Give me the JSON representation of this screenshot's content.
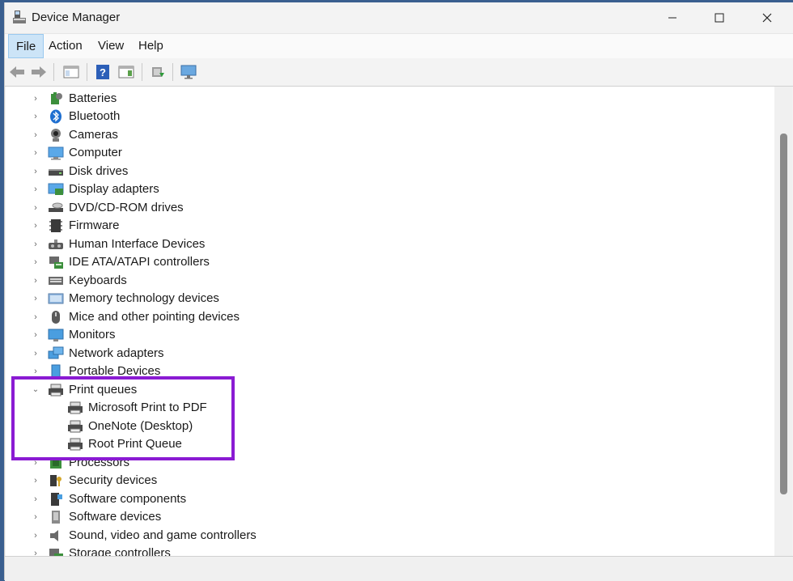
{
  "window": {
    "title": "Device Manager"
  },
  "menu": [
    {
      "label": "File"
    },
    {
      "label": "Action"
    },
    {
      "label": "View"
    },
    {
      "label": "Help"
    }
  ],
  "tree": {
    "items": [
      {
        "label": "Batteries",
        "icon": "battery-icon"
      },
      {
        "label": "Bluetooth",
        "icon": "bluetooth-icon"
      },
      {
        "label": "Cameras",
        "icon": "camera-icon"
      },
      {
        "label": "Computer",
        "icon": "computer-icon"
      },
      {
        "label": "Disk drives",
        "icon": "disk-drive-icon"
      },
      {
        "label": "Display adapters",
        "icon": "display-adapter-icon"
      },
      {
        "label": "DVD/CD-ROM drives",
        "icon": "dvd-drive-icon"
      },
      {
        "label": "Firmware",
        "icon": "firmware-icon"
      },
      {
        "label": "Human Interface Devices",
        "icon": "hid-icon"
      },
      {
        "label": "IDE ATA/ATAPI controllers",
        "icon": "ide-controller-icon"
      },
      {
        "label": "Keyboards",
        "icon": "keyboard-icon"
      },
      {
        "label": "Memory technology devices",
        "icon": "memory-icon"
      },
      {
        "label": "Mice and other pointing devices",
        "icon": "mouse-icon"
      },
      {
        "label": "Monitors",
        "icon": "monitor-icon"
      },
      {
        "label": "Network adapters",
        "icon": "network-adapter-icon"
      },
      {
        "label": "Portable Devices",
        "icon": "portable-device-icon"
      },
      {
        "label": "Print queues",
        "icon": "printer-icon",
        "expanded": true
      },
      {
        "label": "Microsoft Print to PDF",
        "icon": "printer-icon",
        "child": true
      },
      {
        "label": "OneNote (Desktop)",
        "icon": "printer-icon",
        "child": true
      },
      {
        "label": "Root Print Queue",
        "icon": "printer-icon",
        "child": true
      },
      {
        "label": "Processors",
        "icon": "processor-icon"
      },
      {
        "label": "Security devices",
        "icon": "security-device-icon"
      },
      {
        "label": "Software components",
        "icon": "software-component-icon"
      },
      {
        "label": "Software devices",
        "icon": "software-device-icon"
      },
      {
        "label": "Sound, video and game controllers",
        "icon": "speaker-icon"
      },
      {
        "label": "Storage controllers",
        "icon": "storage-controller-icon"
      }
    ]
  },
  "colors": {
    "highlight": "#8a1bd3",
    "accent": "#1f6fd0"
  }
}
